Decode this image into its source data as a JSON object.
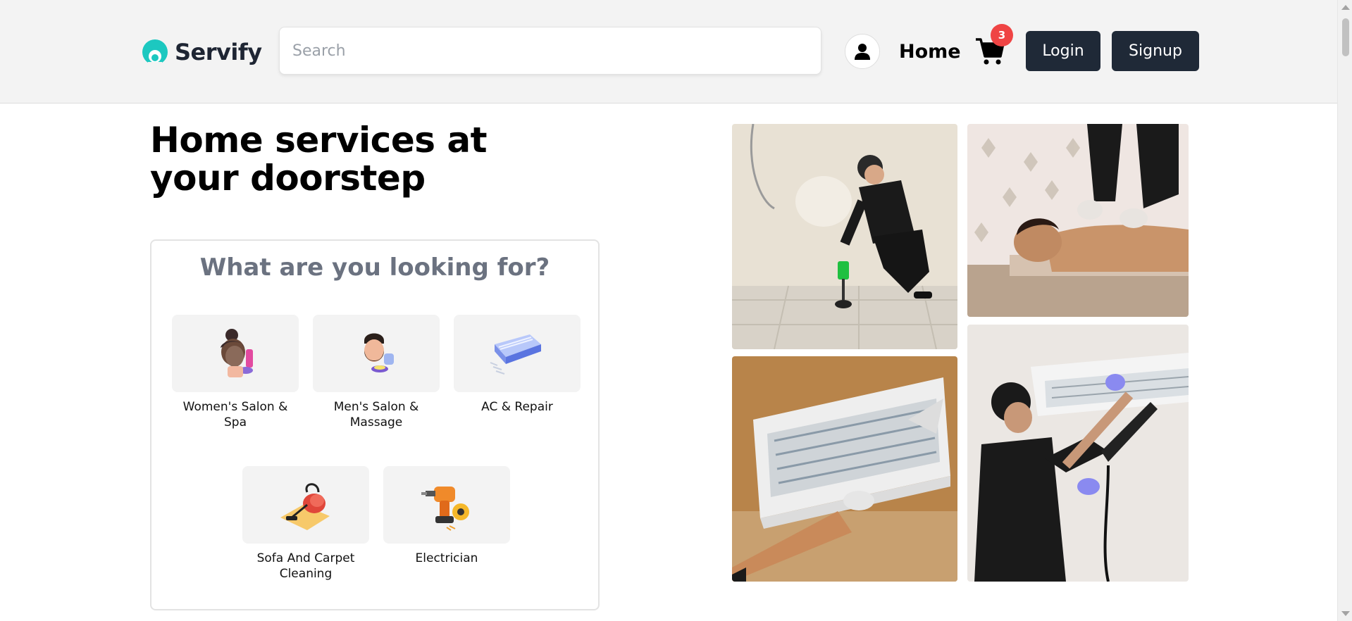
{
  "brand": {
    "name": "Servify",
    "accent": "#1cc8c0"
  },
  "search": {
    "placeholder": "Search",
    "value": ""
  },
  "nav": {
    "home_label": "Home",
    "cart_count": "3",
    "login_label": "Login",
    "signup_label": "Signup"
  },
  "hero": {
    "title": "Home services at your doorstep"
  },
  "panel": {
    "title": "What are you looking for?",
    "services": [
      {
        "label": "Women's Salon & Spa",
        "icon": "women-salon-icon"
      },
      {
        "label": "Men's Salon & Massage",
        "icon": "men-salon-icon"
      },
      {
        "label": "AC & Repair",
        "icon": "ac-unit-icon"
      },
      {
        "label": "Sofa And Carpet Cleaning",
        "icon": "vacuum-cleaner-icon"
      },
      {
        "label": "Electrician",
        "icon": "drill-icon"
      }
    ]
  },
  "colors": {
    "dark_button": "#1f2937",
    "badge": "#ef4444",
    "panel_title": "#6b7280",
    "header_bg": "#f3f3f3"
  }
}
